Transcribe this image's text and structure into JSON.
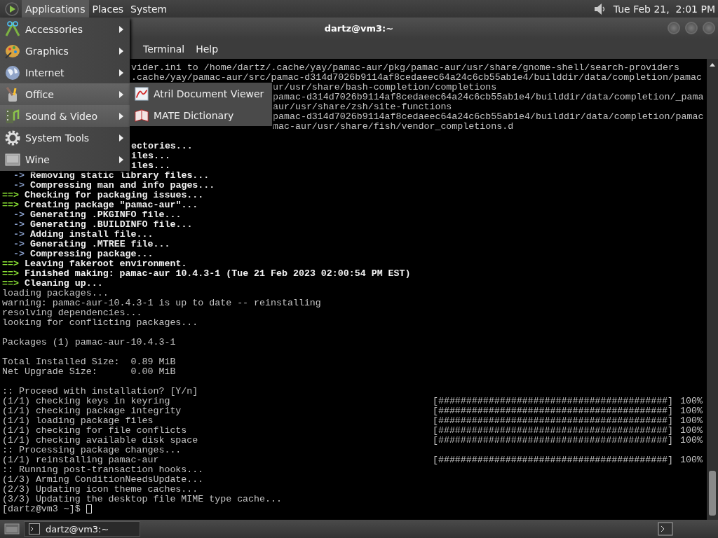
{
  "top_panel": {
    "menus": [
      {
        "label": "Applications",
        "open": true
      },
      {
        "label": "Places",
        "open": false
      },
      {
        "label": "System",
        "open": false
      }
    ],
    "clock": "Tue Feb 21,  2:01 PM"
  },
  "window": {
    "title": "dartz@vm3:~",
    "menubar": [
      "Terminal",
      "Help"
    ]
  },
  "applications_menu": {
    "items": [
      {
        "label": "Accessories",
        "highlighted": false
      },
      {
        "label": "Graphics",
        "highlighted": false
      },
      {
        "label": "Internet",
        "highlighted": false
      },
      {
        "label": "Office",
        "highlighted": true
      },
      {
        "label": "Sound & Video",
        "highlighted": true
      },
      {
        "label": "System Tools",
        "highlighted": false
      },
      {
        "label": "Wine",
        "highlighted": false
      }
    ]
  },
  "submenu": {
    "items": [
      {
        "label": "Atril Document Viewer"
      },
      {
        "label": "MATE Dictionary"
      }
    ]
  },
  "terminal": {
    "lines": [
      {
        "kind": "cut_menu",
        "bold": false,
        "text": "vider.ini to /home/dartz/.cache/yay/pamac-aur/pkg/pamac-aur/usr/share/gnome-shell/search-providers"
      },
      {
        "kind": "cut_menu",
        "bold": false,
        "text": ".cache/yay/pamac-aur/src/pamac-d314d7026b9114af8cedaeec64a24c6cb55ab1e4/builddir/data/completion/pamac"
      },
      {
        "kind": "cut_submenu",
        "bold": false,
        "text": "ur/usr/share/bash-completion/completions"
      },
      {
        "kind": "cut_submenu",
        "bold": false,
        "text": "pamac-d314d7026b9114af8cedaeec64a24c6cb55ab1e4/builddir/data/completion/_pama"
      },
      {
        "kind": "cut_submenu",
        "bold": false,
        "text": "aur/usr/share/zsh/site-functions"
      },
      {
        "kind": "cut_submenu",
        "bold": false,
        "text": "pamac-d314d7026b9114af8cedaeec64a24c6cb55ab1e4/builddir/data/completion/pamac"
      },
      {
        "kind": "cut_submenu",
        "bold": false,
        "text": "mac-aur/usr/share/fish/vendor_completions.d"
      },
      {
        "kind": "blank"
      },
      {
        "kind": "cut_menu",
        "bold": true,
        "text": "ectories..."
      },
      {
        "kind": "cut_menu",
        "bold": true,
        "text": "iles..."
      },
      {
        "kind": "cut_menu",
        "bold": true,
        "text": "iles..."
      },
      {
        "kind": "step",
        "mark": "->",
        "text": "Removing static library files..."
      },
      {
        "kind": "step",
        "mark": "->",
        "text": "Compressing man and info pages..."
      },
      {
        "kind": "section",
        "mark": "==>",
        "text": "Checking for packaging issues..."
      },
      {
        "kind": "section",
        "mark": "==>",
        "text": "Creating package \"pamac-aur\"..."
      },
      {
        "kind": "step",
        "mark": "->",
        "text": "Generating .PKGINFO file..."
      },
      {
        "kind": "step",
        "mark": "->",
        "text": "Generating .BUILDINFO file..."
      },
      {
        "kind": "step",
        "mark": "->",
        "text": "Adding install file..."
      },
      {
        "kind": "step",
        "mark": "->",
        "text": "Generating .MTREE file..."
      },
      {
        "kind": "step",
        "mark": "->",
        "text": "Compressing package..."
      },
      {
        "kind": "section",
        "mark": "==>",
        "text": "Leaving fakeroot environment."
      },
      {
        "kind": "section",
        "mark": "==>",
        "text": "Finished making: pamac-aur 10.4.3-1 (Tue 21 Feb 2023 02:00:54 PM EST)"
      },
      {
        "kind": "section",
        "mark": "==>",
        "text": "Cleaning up..."
      },
      {
        "kind": "plain",
        "text": "loading packages..."
      },
      {
        "kind": "plain",
        "text": "warning: pamac-aur-10.4.3-1 is up to date -- reinstalling"
      },
      {
        "kind": "plain",
        "text": "resolving dependencies..."
      },
      {
        "kind": "plain",
        "text": "looking for conflicting packages..."
      },
      {
        "kind": "blank"
      },
      {
        "kind": "plain",
        "text": "Packages (1) pamac-aur-10.4.3-1"
      },
      {
        "kind": "blank"
      },
      {
        "kind": "plain",
        "text": "Total Installed Size:  0.89 MiB"
      },
      {
        "kind": "plain",
        "text": "Net Upgrade Size:      0.00 MiB"
      },
      {
        "kind": "blank"
      },
      {
        "kind": "plain",
        "text": ":: Proceed with installation? [Y/n]"
      },
      {
        "kind": "progress",
        "text": "(1/1) checking keys in keyring",
        "bar": "[#########################################]",
        "percent": "100%"
      },
      {
        "kind": "progress",
        "text": "(1/1) checking package integrity",
        "bar": "[#########################################]",
        "percent": "100%"
      },
      {
        "kind": "progress",
        "text": "(1/1) loading package files",
        "bar": "[#########################################]",
        "percent": "100%"
      },
      {
        "kind": "progress",
        "text": "(1/1) checking for file conflicts",
        "bar": "[#########################################]",
        "percent": "100%"
      },
      {
        "kind": "progress",
        "text": "(1/1) checking available disk space",
        "bar": "[#########################################]",
        "percent": "100%"
      },
      {
        "kind": "plain",
        "text": ":: Processing package changes..."
      },
      {
        "kind": "progress",
        "text": "(1/1) reinstalling pamac-aur",
        "bar": "[#########################################]",
        "percent": "100%"
      },
      {
        "kind": "plain",
        "text": ":: Running post-transaction hooks..."
      },
      {
        "kind": "plain",
        "text": "(1/3) Arming ConditionNeedsUpdate..."
      },
      {
        "kind": "plain",
        "text": "(2/3) Updating icon theme caches..."
      },
      {
        "kind": "plain",
        "text": "(3/3) Updating the desktop file MIME type cache..."
      },
      {
        "kind": "prompt",
        "text": "[dartz@vm3 ~]$"
      }
    ]
  },
  "taskbar": {
    "tasks": [
      {
        "label": "dartz@vm3:~"
      }
    ]
  }
}
